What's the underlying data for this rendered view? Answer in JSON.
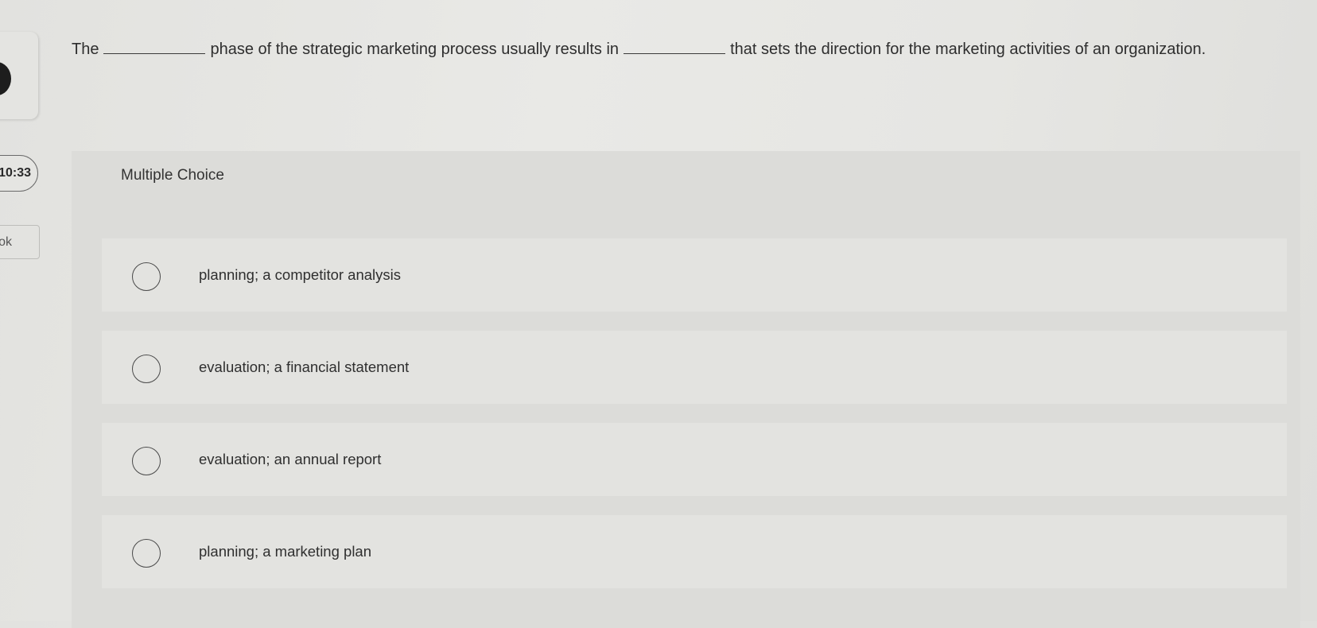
{
  "sidebar": {
    "timer": "10:33",
    "ebook_tab": "ok"
  },
  "question": {
    "part1": "The",
    "part2": "phase of the strategic marketing process usually results in",
    "part3": "that sets the direction for the marketing activities of an organization."
  },
  "multiple_choice": {
    "label": "Multiple Choice",
    "options": [
      {
        "text": "planning; a competitor analysis"
      },
      {
        "text": "evaluation; a financial statement"
      },
      {
        "text": "evaluation; an annual report"
      },
      {
        "text": "planning; a marketing plan"
      }
    ]
  },
  "colors": {
    "background": "#e6e6e3",
    "panel": "#dcdcd9",
    "option_bg": "#e3e3e0",
    "text": "#2e2e2e"
  }
}
